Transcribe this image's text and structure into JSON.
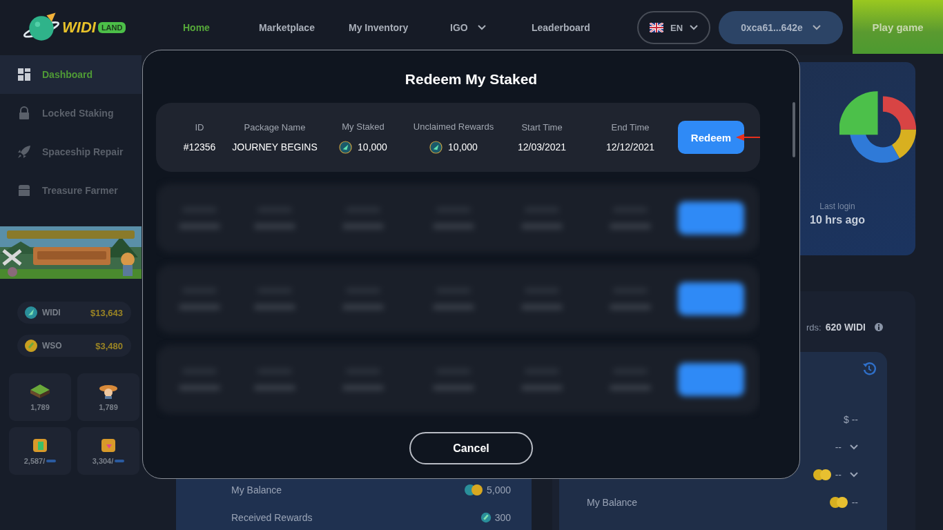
{
  "header": {
    "logo": {
      "word": "WIDI",
      "tag": "LAND"
    },
    "nav": [
      {
        "label": "Home",
        "selected": true,
        "kind": "link"
      },
      {
        "label": "Marketplace",
        "selected": false,
        "kind": "link"
      },
      {
        "label": "My Inventory",
        "selected": false,
        "kind": "link"
      },
      {
        "label": "IGO",
        "selected": false,
        "kind": "dropdown"
      },
      {
        "label": "Leaderboard",
        "selected": false,
        "kind": "link"
      }
    ],
    "language": "EN",
    "wallet": "0xca61...642e",
    "play": "Play game"
  },
  "sidebar": {
    "items": [
      {
        "label": "Dashboard",
        "selected": true,
        "kind": "grid"
      },
      {
        "label": "Locked Staking",
        "selected": false,
        "kind": "lock"
      },
      {
        "label": "Spaceship Repair",
        "selected": false,
        "kind": "rocket"
      },
      {
        "label": "Treasure Farmer",
        "selected": false,
        "kind": "chest"
      }
    ],
    "tokens": [
      {
        "name": "WIDI",
        "value": "$13,643",
        "kind": "widi"
      },
      {
        "name": "WSO",
        "value": "$3,480",
        "kind": "wso"
      }
    ],
    "tiles": [
      {
        "value": "1,789",
        "kind": "land"
      },
      {
        "value": "1,789",
        "kind": "farmer"
      },
      {
        "value": "2,587/",
        "kind": "chest-green"
      },
      {
        "value": "3,304/",
        "kind": "chest-pink"
      }
    ]
  },
  "dashboard": {
    "last_login": {
      "label": "Last login",
      "value": "10 hrs ago"
    },
    "staking": {
      "rewards_label": "rds:",
      "rewards_value": "620 WIDI",
      "rows": [
        {
          "value": "$ --",
          "kind": "plain"
        },
        {
          "value": "--",
          "kind": "dropdown"
        },
        {
          "value": "--",
          "kind": "coins-dropdown"
        },
        {
          "label": "My Balance",
          "value": "--",
          "kind": "coins"
        }
      ]
    },
    "balance": {
      "rows": [
        {
          "label": "My Balance",
          "value": "5,000",
          "kind": "coins"
        },
        {
          "label": "Received Rewards",
          "value": "300",
          "kind": "coin"
        }
      ]
    }
  },
  "modal": {
    "title": "Redeem My Staked",
    "columns": [
      "ID",
      "Package Name",
      "My Staked",
      "Unclaimed Rewards",
      "Start Time",
      "End Time"
    ],
    "rows": [
      {
        "kind": "clear",
        "id": "#12356",
        "package": "JOURNEY BEGINS",
        "staked": "10,000",
        "rewards": "10,000",
        "start": "12/03/2021",
        "end": "12/12/2021",
        "action": "Redeem"
      },
      {
        "kind": "blurred"
      },
      {
        "kind": "blurred"
      },
      {
        "kind": "blurred"
      }
    ],
    "cancel": "Cancel"
  }
}
